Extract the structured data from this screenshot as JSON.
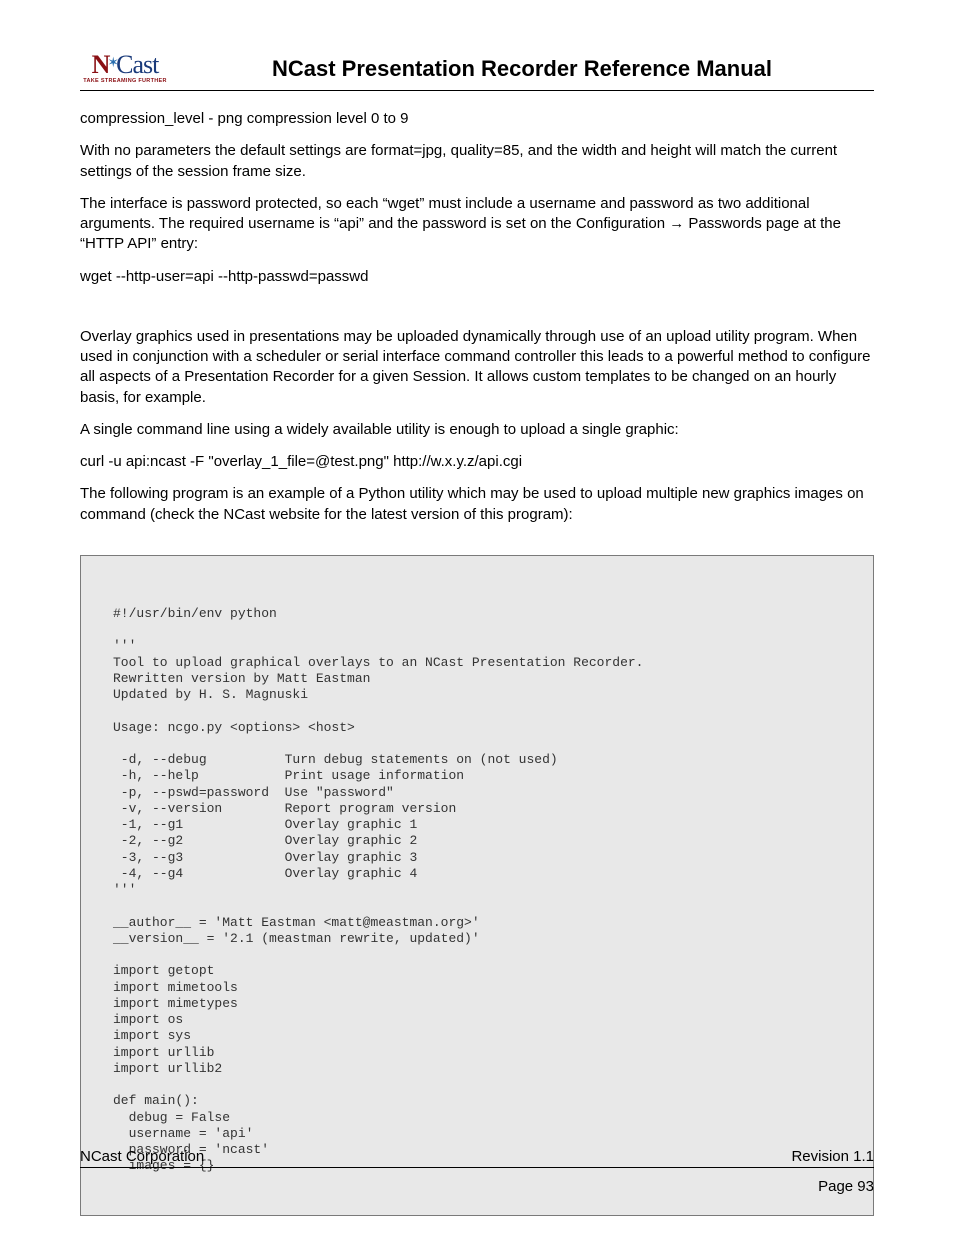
{
  "logo": {
    "n": "N",
    "cast": "Cast",
    "tagline": "TAKE STREAMING FURTHER"
  },
  "docTitle": "NCast Presentation Recorder Reference Manual",
  "body": {
    "p1": "compression_level - png compression level 0 to 9",
    "p2": "With no parameters the default settings are format=jpg, quality=85, and the width and height will match the current settings of the session frame size.",
    "p3": "The interface is password protected, so each “wget” must include a username and password as two additional arguments. The required username is “api” and the password is set on the Configuration → Passwords page at the “HTTP API” entry:",
    "p4": "wget --http-user=api --http-passwd=passwd",
    "p5": "Overlay graphics used in presentations may be uploaded dynamically through use of an upload utility program. When used in conjunction with a scheduler or serial interface command controller this leads to a powerful method to configure all aspects of a Presentation Recorder for a given Session. It allows custom templates to be changed on an hourly basis, for example.",
    "p6": "A single command line using a widely available utility is enough to upload a single graphic:",
    "p7": "curl -u api:ncast -F \"overlay_1_file=@test.png\" http://w.x.y.z/api.cgi",
    "p8": "The following program is an example of a Python utility which may be used to upload multiple new graphics images on command (check the NCast website for the latest version of this program):"
  },
  "code": "#!/usr/bin/env python\n\n'''\nTool to upload graphical overlays to an NCast Presentation Recorder.\nRewritten version by Matt Eastman\nUpdated by H. S. Magnuski\n\nUsage: ncgo.py <options> <host>\n\n -d, --debug          Turn debug statements on (not used)\n -h, --help           Print usage information\n -p, --pswd=password  Use \"password\"\n -v, --version        Report program version\n -1, --g1             Overlay graphic 1\n -2, --g2             Overlay graphic 2\n -3, --g3             Overlay graphic 3\n -4, --g4             Overlay graphic 4\n'''\n\n__author__ = 'Matt Eastman <matt@meastman.org>'\n__version__ = '2.1 (meastman rewrite, updated)'\n\nimport getopt\nimport mimetools\nimport mimetypes\nimport os\nimport sys\nimport urllib\nimport urllib2\n\ndef main():\n  debug = False\n  username = 'api'\n  password = 'ncast'\n  images = {}",
  "footer": {
    "left": "NCast Corporation",
    "right": "Revision 1.1",
    "page": "Page 93"
  }
}
